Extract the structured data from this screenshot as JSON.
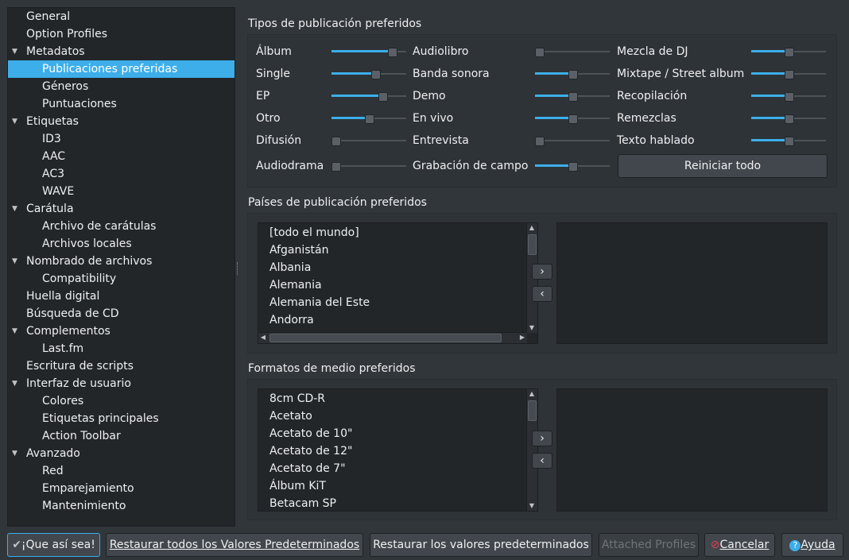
{
  "sidebar": {
    "items": [
      {
        "label": "General",
        "level": 0,
        "expandable": false
      },
      {
        "label": "Option Profiles",
        "level": 0,
        "expandable": false
      },
      {
        "label": "Metadatos",
        "level": 0,
        "expandable": true
      },
      {
        "label": "Publicaciones preferidas",
        "level": 1,
        "expandable": false,
        "selected": true
      },
      {
        "label": "Géneros",
        "level": 1,
        "expandable": false
      },
      {
        "label": "Puntuaciones",
        "level": 1,
        "expandable": false
      },
      {
        "label": "Etiquetas",
        "level": 0,
        "expandable": true
      },
      {
        "label": "ID3",
        "level": 1,
        "expandable": false
      },
      {
        "label": "AAC",
        "level": 1,
        "expandable": false
      },
      {
        "label": "AC3",
        "level": 1,
        "expandable": false
      },
      {
        "label": "WAVE",
        "level": 1,
        "expandable": false
      },
      {
        "label": "Carátula",
        "level": 0,
        "expandable": true
      },
      {
        "label": "Archivo de carátulas",
        "level": 1,
        "expandable": false
      },
      {
        "label": "Archivos locales",
        "level": 1,
        "expandable": false
      },
      {
        "label": "Nombrado de archivos",
        "level": 0,
        "expandable": true
      },
      {
        "label": "Compatibility",
        "level": 1,
        "expandable": false
      },
      {
        "label": "Huella digital",
        "level": 0,
        "expandable": false
      },
      {
        "label": "Búsqueda de CD",
        "level": 0,
        "expandable": false
      },
      {
        "label": "Complementos",
        "level": 0,
        "expandable": true
      },
      {
        "label": "Last.fm",
        "level": 1,
        "expandable": false
      },
      {
        "label": "Escritura de scripts",
        "level": 0,
        "expandable": false
      },
      {
        "label": "Interfaz de usuario",
        "level": 0,
        "expandable": true
      },
      {
        "label": "Colores",
        "level": 1,
        "expandable": false
      },
      {
        "label": "Etiquetas principales",
        "level": 1,
        "expandable": false
      },
      {
        "label": "Action Toolbar",
        "level": 1,
        "expandable": false
      },
      {
        "label": "Avanzado",
        "level": 0,
        "expandable": true
      },
      {
        "label": "Red",
        "level": 1,
        "expandable": false
      },
      {
        "label": "Emparejamiento",
        "level": 1,
        "expandable": false
      },
      {
        "label": "Mantenimiento",
        "level": 1,
        "expandable": false
      }
    ]
  },
  "release_types": {
    "title": "Tipos de publicación preferidos",
    "columns": [
      [
        {
          "label": "Álbum",
          "value": 0.85
        },
        {
          "label": "Single",
          "value": 0.6
        },
        {
          "label": "EP",
          "value": 0.7
        },
        {
          "label": "Otro",
          "value": 0.5
        },
        {
          "label": "Difusión",
          "value": 0.0
        },
        {
          "label": "Audiodrama",
          "value": 0.0
        }
      ],
      [
        {
          "label": "Audiolibro",
          "value": 0.0
        },
        {
          "label": "Banda sonora",
          "value": 0.5
        },
        {
          "label": "Demo",
          "value": 0.5
        },
        {
          "label": "En vivo",
          "value": 0.5
        },
        {
          "label": "Entrevista",
          "value": 0.0
        },
        {
          "label": "Grabación de campo",
          "value": 0.5
        }
      ],
      [
        {
          "label": "Mezcla de DJ",
          "value": 0.5
        },
        {
          "label": "Mixtape / Street album",
          "value": 0.5
        },
        {
          "label": "Recopilación",
          "value": 0.5
        },
        {
          "label": "Remezclas",
          "value": 0.5
        },
        {
          "label": "Texto hablado",
          "value": 0.5
        }
      ]
    ],
    "reset_label": "Reiniciar todo"
  },
  "countries": {
    "title": "Países de publicación preferidos",
    "items": [
      "[todo el mundo]",
      "Afganistán",
      "Albania",
      "Alemania",
      "Alemania del Este",
      "Andorra"
    ]
  },
  "formats": {
    "title": "Formatos de medio preferidos",
    "items": [
      "8cm CD-R",
      "Acetato",
      "Acetato de 10\"",
      "Acetato de 12\"",
      "Acetato de 7\"",
      "Álbum KiT",
      "Betacam SP"
    ]
  },
  "icons": {
    "add": "chevron-right-icon",
    "remove": "chevron-left-icon",
    "ok": "check-icon",
    "cancel": "cancel-icon",
    "help": "help-icon",
    "tree_expand": "triangle-down-icon"
  },
  "colors": {
    "accent": "#3daee9",
    "background": "#31363b",
    "panel": "#232629",
    "cancel_icon": "#da4453"
  },
  "footer": {
    "ok_label": "¡Que así sea!",
    "restore_all_label": "Restaurar todos los Valores Predeterminados",
    "restore_label": "Restaurar los valores predeterminados",
    "attached_profiles_label": "Attached Profiles",
    "cancel_label": "Cancelar",
    "help_label": "Ayuda"
  }
}
